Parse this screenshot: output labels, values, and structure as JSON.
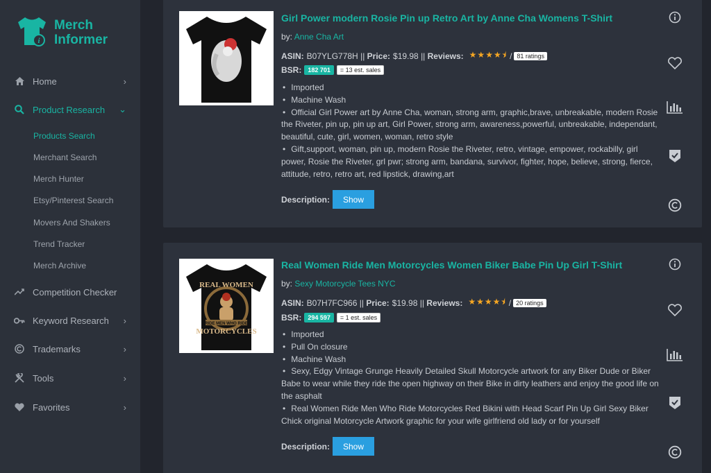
{
  "sidebar": {
    "logo": {
      "line1": "Merch",
      "line2": "Informer"
    },
    "items": [
      {
        "label": "Home",
        "icon": "home-icon"
      },
      {
        "label": "Product Research",
        "icon": "search-icon",
        "active": true
      },
      {
        "label": "Competition Checker",
        "icon": "trend-icon"
      },
      {
        "label": "Keyword Research",
        "icon": "key-icon"
      },
      {
        "label": "Trademarks",
        "icon": "copyright-icon"
      },
      {
        "label": "Tools",
        "icon": "tools-icon"
      },
      {
        "label": "Favorites",
        "icon": "heart-icon"
      }
    ],
    "subitems": [
      {
        "label": "Products Search",
        "active": true
      },
      {
        "label": "Merchant Search"
      },
      {
        "label": "Merch Hunter"
      },
      {
        "label": "Etsy/Pinterest Search"
      },
      {
        "label": "Movers And Shakers"
      },
      {
        "label": "Trend Tracker"
      },
      {
        "label": "Merch Archive"
      }
    ]
  },
  "products": [
    {
      "title": "Girl Power modern Rosie Pin up Retro Art by Anne Cha Womens T-Shirt",
      "by_label": "by:",
      "brand": "Anne Cha Art",
      "asin_label": "ASIN:",
      "asin": "B07YLG778H",
      "sep": "||",
      "price_label": "Price:",
      "price": "$19.98",
      "reviews_label": "Reviews:",
      "rating": 4.5,
      "slash": "/",
      "ratings": "81 ratings",
      "bsr_label": "BSR:",
      "bsr": "182 701",
      "est_sales": "= 13 est. sales",
      "bullets": [
        "Imported",
        "Machine Wash",
        "Official Girl Power art by Anne Cha, woman, strong arm, graphic,brave, unbreakable, modern Rosie the Riveter, pin up, pin up art, Girl Power, strong arm, awareness,powerful, unbreakable, independant, beautiful, cute, girl, women, woman, retro style",
        "Gift,support, woman, pin up, modern Rosie the Riveter, retro, vintage, empower, rockabilly, girl power, Rosie the Riveter, grl pwr; strong arm, bandana, survivor, fighter, hope, believe, strong, fierce, attitude, retro, retro art, red lipstick, drawing,art"
      ],
      "desc_label": "Description:",
      "show_label": "Show"
    },
    {
      "title": "Real Women Ride Men Motorcycles Women Biker Babe Pin Up Girl T-Shirt",
      "by_label": "by:",
      "brand": "Sexy Motorcycle Tees NYC",
      "asin_label": "ASIN:",
      "asin": "B07H7FC966",
      "sep": "||",
      "price_label": "Price:",
      "price": "$19.98",
      "reviews_label": "Reviews:",
      "rating": 4.5,
      "slash": "/",
      "ratings": "20 ratings",
      "bsr_label": "BSR:",
      "bsr": "294 597",
      "est_sales": "= 1 est. sales",
      "bullets": [
        "Imported",
        "Pull On closure",
        "Machine Wash",
        "Sexy, Edgy Vintage Grunge Heavily Detailed Skull Motorcycle artwork for any Biker Dude or Biker Babe to wear while they ride the open highway on their Bike in dirty leathers and enjoy the good life on the asphalt",
        "Real Women Ride Men Who Ride Motorcycles Red Bikini with Head Scarf Pin Up Girl Sexy Biker Chick original Motorcycle Artwork graphic for your wife girlfriend old lady or for yourself"
      ],
      "desc_label": "Description:",
      "show_label": "Show",
      "shirt_print": {
        "line1": "REAL WOMEN",
        "line2": "RIDE MEN WHO RIDE",
        "line3": "MOTORCYCLES"
      }
    }
  ],
  "colors": {
    "accent": "#19b5a3",
    "button": "#2a9fe0",
    "star": "#f5a623"
  }
}
